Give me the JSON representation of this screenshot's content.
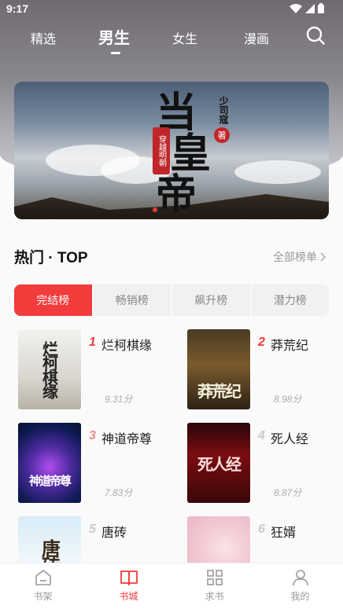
{
  "status_bar": {
    "time": "9:17"
  },
  "top_tabs": [
    {
      "label": "精选",
      "active": false
    },
    {
      "label": "男生",
      "active": true
    },
    {
      "label": "女生",
      "active": false
    },
    {
      "label": "漫画",
      "active": false
    }
  ],
  "banner": {
    "title_chars": [
      "当",
      "皇",
      "帝"
    ],
    "subtitle": "穿越明朝",
    "author": "少司寇",
    "author_seal": "著"
  },
  "section": {
    "title": "热门 · TOP",
    "more": "全部榜单"
  },
  "rank_tabs": [
    {
      "label": "完结榜",
      "active": true
    },
    {
      "label": "畅销榜",
      "active": false
    },
    {
      "label": "飙升榜",
      "active": false
    },
    {
      "label": "潜力榜",
      "active": false
    }
  ],
  "books": [
    {
      "rank": "1",
      "name": "烂柯棋缘",
      "score": "9.31分",
      "cover_text": "烂柯棋缘"
    },
    {
      "rank": "2",
      "name": "莽荒纪",
      "score": "8.98分",
      "cover_text": "莽荒纪"
    },
    {
      "rank": "3",
      "name": "神道帝尊",
      "score": "7.83分",
      "cover_text": "神道帝尊"
    },
    {
      "rank": "4",
      "name": "死人经",
      "score": "8.87分",
      "cover_text": "死人经"
    },
    {
      "rank": "5",
      "name": "唐砖",
      "score": "",
      "cover_text": "唐砖"
    },
    {
      "rank": "6",
      "name": "狂婿",
      "score": "",
      "cover_text": ""
    }
  ],
  "bottom_nav": [
    {
      "label": "书架",
      "icon": "bookshelf-icon",
      "active": false
    },
    {
      "label": "书城",
      "icon": "book-open-icon",
      "active": true
    },
    {
      "label": "求书",
      "icon": "grid-icon",
      "active": false
    },
    {
      "label": "我的",
      "icon": "user-icon",
      "active": false
    }
  ],
  "colors": {
    "accent": "#f23b3b"
  }
}
